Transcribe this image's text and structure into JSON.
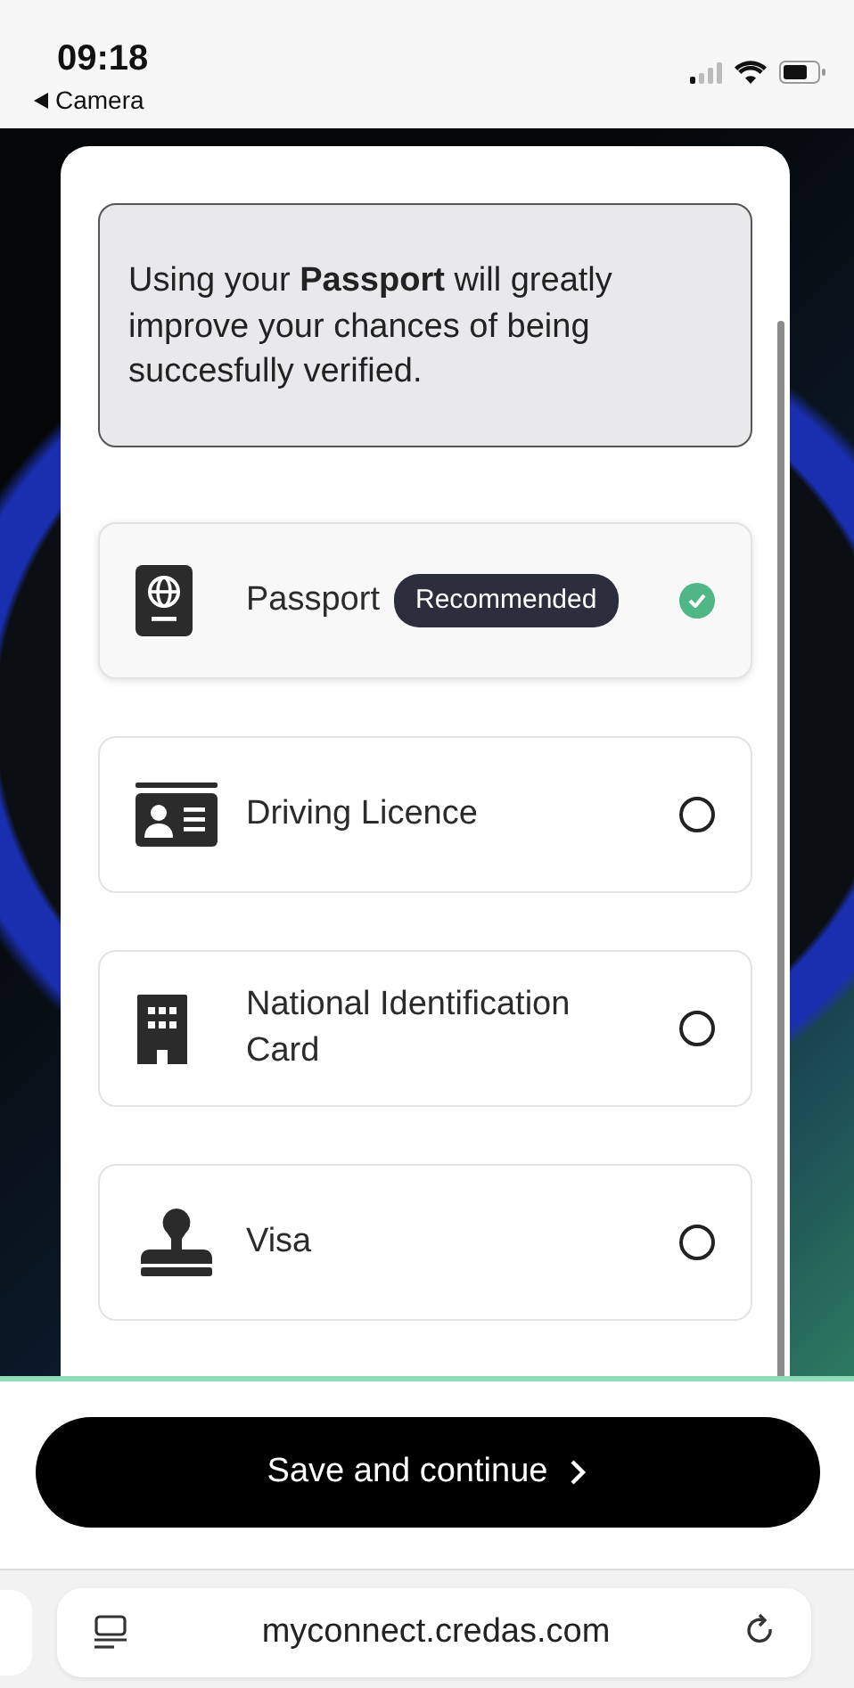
{
  "status_bar": {
    "time": "09:18",
    "back_label": "Camera"
  },
  "info_box": {
    "text": "Using your **Passport** will greatly improve your chances of being succesfully verified."
  },
  "options": [
    {
      "kind": "passport",
      "label": "Passport",
      "badge": "Recommended",
      "selected": true
    },
    {
      "kind": "licence",
      "label": "Driving Licence",
      "selected": false
    },
    {
      "kind": "building",
      "label": "National Identification Card",
      "selected": false
    },
    {
      "kind": "stamp",
      "label": "Visa",
      "selected": false
    }
  ],
  "save_button": {
    "label": "Save and continue"
  },
  "browser_bar": {
    "url": "myconnect.credas.com"
  }
}
